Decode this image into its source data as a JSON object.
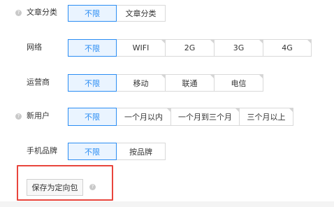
{
  "help_icon_glyph": "?",
  "colors": {
    "accent": "#2b8df3",
    "selected_bg": "#eaf4ff",
    "highlight_border": "#e8453c"
  },
  "rows": {
    "article_category": {
      "label": "文章分类",
      "options": [
        "不限",
        "文章分类"
      ],
      "selected": "不限"
    },
    "network": {
      "label": "网络",
      "options": [
        "不限",
        "WIFI",
        "2G",
        "3G",
        "4G"
      ],
      "selected": "不限"
    },
    "carrier": {
      "label": "运营商",
      "options": [
        "不限",
        "移动",
        "联通",
        "电信"
      ],
      "selected": "不限"
    },
    "new_user": {
      "label": "新用户",
      "options": [
        "不限",
        "一个月以内",
        "一个月到三个月",
        "三个月以上"
      ],
      "selected": "不限"
    },
    "phone_brand": {
      "label": "手机品牌",
      "options": [
        "不限",
        "按品牌"
      ],
      "selected": "不限"
    }
  },
  "save": {
    "label": "保存为定向包"
  }
}
